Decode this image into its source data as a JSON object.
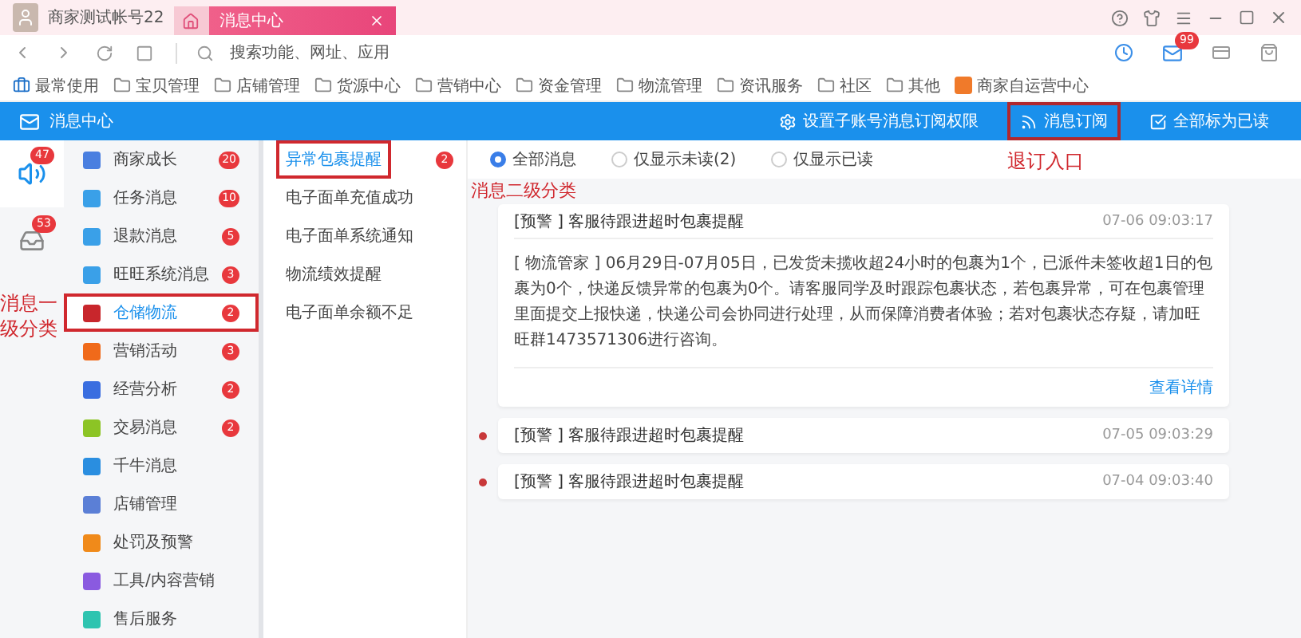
{
  "window": {
    "account": "商家测试帐号22",
    "tabs": [
      {
        "label": "消息中心",
        "selected": true
      }
    ]
  },
  "address_bar": {
    "placeholder": "搜索功能、网址、应用"
  },
  "mail_badge": "99",
  "bookmarks": [
    {
      "label": "最常使用",
      "kind": "briefcase"
    },
    {
      "label": "宝贝管理",
      "kind": "folder"
    },
    {
      "label": "店铺管理",
      "kind": "folder"
    },
    {
      "label": "货源中心",
      "kind": "folder"
    },
    {
      "label": "营销中心",
      "kind": "folder"
    },
    {
      "label": "资金管理",
      "kind": "folder"
    },
    {
      "label": "物流管理",
      "kind": "folder"
    },
    {
      "label": "资讯服务",
      "kind": "folder"
    },
    {
      "label": "社区",
      "kind": "folder"
    },
    {
      "label": "其他",
      "kind": "folder"
    },
    {
      "label": "商家自运营中心",
      "kind": "app"
    }
  ],
  "header": {
    "title": "消息中心",
    "actions": [
      {
        "label": "设置子账号消息订阅权限",
        "kind": "settings",
        "annotated": false
      },
      {
        "label": "消息订阅",
        "kind": "rss",
        "annotated": true,
        "note": "退订入口"
      },
      {
        "label": "全部标为已读",
        "kind": "check",
        "annotated": false
      }
    ]
  },
  "rail": [
    {
      "kind": "speaker",
      "badge": "47",
      "selected": true
    },
    {
      "kind": "inbox",
      "badge": "53",
      "selected": false
    }
  ],
  "categories": [
    {
      "label": "商家成长",
      "count": "20",
      "color": "#4a7fe0",
      "selected": false,
      "annotated": false
    },
    {
      "label": "任务消息",
      "count": "10",
      "color": "#3aa0e8",
      "selected": false,
      "annotated": false
    },
    {
      "label": "退款消息",
      "count": "5",
      "color": "#3aa0e8",
      "selected": false,
      "annotated": false
    },
    {
      "label": "旺旺系统消息",
      "count": "3",
      "color": "#3aa0e8",
      "selected": false,
      "annotated": false
    },
    {
      "label": "仓储物流",
      "count": "2",
      "color": "#c8262c",
      "selected": true,
      "annotated": true,
      "note": "消息一级分类"
    },
    {
      "label": "营销活动",
      "count": "3",
      "color": "#f06a1a",
      "selected": false,
      "annotated": false
    },
    {
      "label": "经营分析",
      "count": "2",
      "color": "#3a6ee0",
      "selected": false,
      "annotated": false
    },
    {
      "label": "交易消息",
      "count": "2",
      "color": "#8cc425",
      "selected": false,
      "annotated": false
    },
    {
      "label": "千牛消息",
      "color": "#2a8ee0",
      "selected": false,
      "annotated": false
    },
    {
      "label": "店铺管理",
      "color": "#5b7fd6",
      "selected": false,
      "annotated": false
    },
    {
      "label": "处罚及预警",
      "color": "#f08a1a",
      "selected": false,
      "annotated": false
    },
    {
      "label": "工具/内容营销",
      "color": "#8a5ae0",
      "selected": false,
      "annotated": false
    },
    {
      "label": "售后服务",
      "color": "#2ec4b0",
      "selected": false,
      "annotated": false
    }
  ],
  "subcategories": [
    {
      "label": "异常包裹提醒",
      "count": "2",
      "selected": true,
      "annotated": true,
      "note": "消息二级分类"
    },
    {
      "label": "电子面单充值成功",
      "selected": false,
      "annotated": false
    },
    {
      "label": "电子面单系统通知",
      "selected": false,
      "annotated": false
    },
    {
      "label": "物流绩效提醒",
      "selected": false,
      "annotated": false
    },
    {
      "label": "电子面单余额不足",
      "selected": false,
      "annotated": false
    }
  ],
  "filters": [
    {
      "label": "全部消息",
      "selected": true
    },
    {
      "label": "仅显示未读(2)",
      "selected": false
    },
    {
      "label": "仅显示已读",
      "selected": false
    }
  ],
  "messages": [
    {
      "title": "[预警 ] 客服待跟进超时包裹提醒",
      "time": "07-06 09:03:17",
      "unread": false,
      "expanded": true,
      "body": "[ 物流管家 ] 06月29日-07月05日，已发货未揽收超24小时的包裹为1个，已派件未签收超1日的包裹为0个，快递反馈异常的包裹为0个。请客服同学及时跟踪包裹状态，若包裹异常，可在包裹管理里面提交上报快递，快递公司会协同进行处理，从而保障消费者体验；若对包裹状态存疑，请加旺旺群1473571306进行咨询。",
      "link": "查看详情"
    },
    {
      "title": "[预警 ] 客服待跟进超时包裹提醒",
      "time": "07-05 09:03:29",
      "unread": true,
      "expanded": false
    },
    {
      "title": "[预警 ] 客服待跟进超时包裹提醒",
      "time": "07-04 09:03:40",
      "unread": true,
      "expanded": false
    }
  ]
}
